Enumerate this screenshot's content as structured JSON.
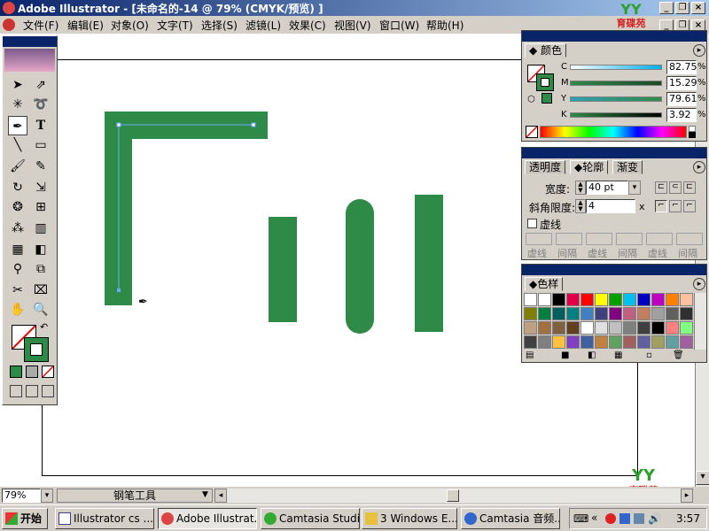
{
  "window": {
    "title": "Adobe Illustrator - [未命名的-14 @ 79% (CMYK/预览) ]"
  },
  "menu": [
    "文件(F)",
    "编辑(E)",
    "对象(O)",
    "文字(T)",
    "选择(S)",
    "滤镜(L)",
    "效果(C)",
    "视图(V)",
    "窗口(W)",
    "帮助(H)"
  ],
  "watermark": "育碟苑",
  "color_panel": {
    "tab": "颜色",
    "channels": [
      {
        "label": "C",
        "value": "82.75",
        "unit": "%"
      },
      {
        "label": "M",
        "value": "15.29",
        "unit": "%"
      },
      {
        "label": "Y",
        "value": "79.61",
        "unit": "%"
      },
      {
        "label": "K",
        "value": "3.92",
        "unit": "%"
      }
    ],
    "channel_levels": [
      0.8275,
      0.1529,
      0.7961,
      0.0392
    ],
    "fill_color": "#2e8b47"
  },
  "stroke_panel": {
    "tabs": [
      "透明度",
      "轮廓",
      "渐变"
    ],
    "width_label": "宽度:",
    "width_value": "40 pt",
    "miter_label": "斜角限度:",
    "miter_value": "4",
    "miter_unit": "x",
    "dashed_label": "虚线",
    "dash_fields": [
      "虚线",
      "间隔",
      "虚线",
      "间隔",
      "虚线",
      "间隔"
    ]
  },
  "swatch_panel": {
    "tab": "色样"
  },
  "status": {
    "zoom": "79%",
    "tool": "钢笔工具"
  },
  "taskbar": {
    "start": "开始",
    "buttons": [
      "Illustrator cs ...",
      "Adobe Illustrat...",
      "Camtasia Studi...",
      "3 Windows E...",
      "Camtasia 音频..."
    ],
    "clock": "3:57"
  },
  "colors": {
    "shape_green": "#2e8b47",
    "title_blue": "#0a246a"
  }
}
